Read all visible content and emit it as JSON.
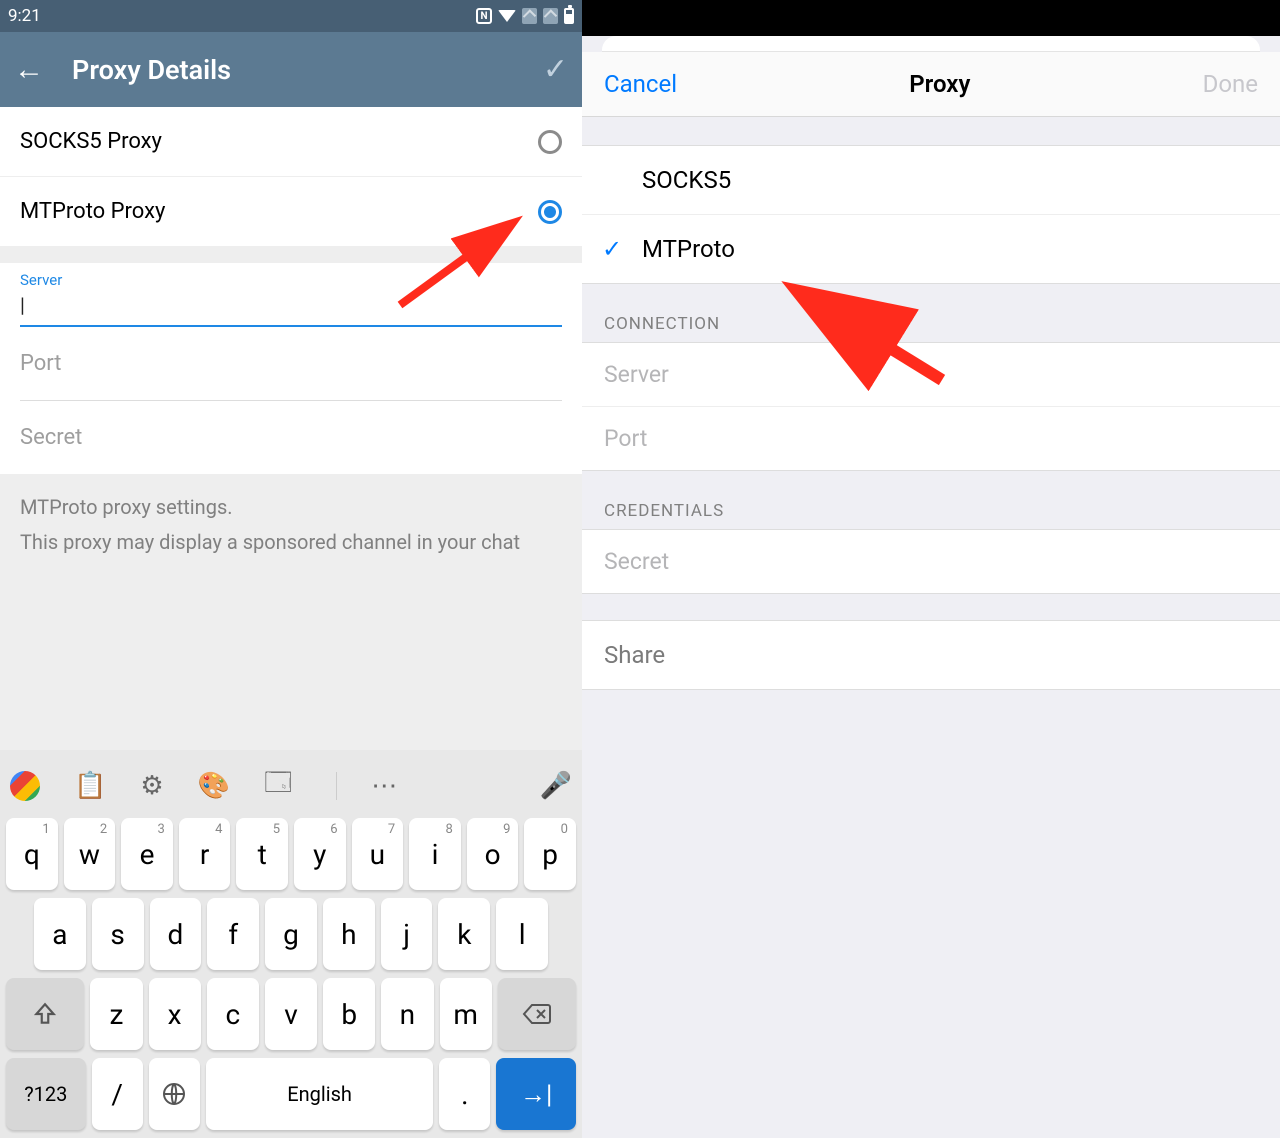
{
  "android": {
    "statusbar": {
      "time": "9:21",
      "nfc_letter": "N"
    },
    "appbar": {
      "title": "Proxy Details"
    },
    "proxy_types": {
      "socks5": "SOCKS5 Proxy",
      "mtproto": "MTProto Proxy"
    },
    "form": {
      "server_label": "Server",
      "server_value": "",
      "port_placeholder": "Port",
      "secret_placeholder": "Secret"
    },
    "info": {
      "line1": "MTProto proxy settings.",
      "line2": "This proxy may display a sponsored channel in your chat"
    },
    "keyboard": {
      "row1": [
        "q",
        "w",
        "e",
        "r",
        "t",
        "y",
        "u",
        "i",
        "o",
        "p"
      ],
      "row1_sup": [
        "1",
        "2",
        "3",
        "4",
        "5",
        "6",
        "7",
        "8",
        "9",
        "0"
      ],
      "row2": [
        "a",
        "s",
        "d",
        "f",
        "g",
        "h",
        "j",
        "k",
        "l"
      ],
      "row3": [
        "z",
        "x",
        "c",
        "v",
        "b",
        "n",
        "m"
      ],
      "symkey": "?123",
      "slash": "/",
      "space": "English",
      "period": "."
    }
  },
  "ios": {
    "nav": {
      "cancel": "Cancel",
      "title": "Proxy",
      "done": "Done"
    },
    "types": {
      "socks5": "SOCKS5",
      "mtproto": "MTProto"
    },
    "sections": {
      "connection": "CONNECTION",
      "credentials": "CREDENTIALS"
    },
    "fields": {
      "server": "Server",
      "port": "Port",
      "secret": "Secret"
    },
    "share": "Share"
  }
}
